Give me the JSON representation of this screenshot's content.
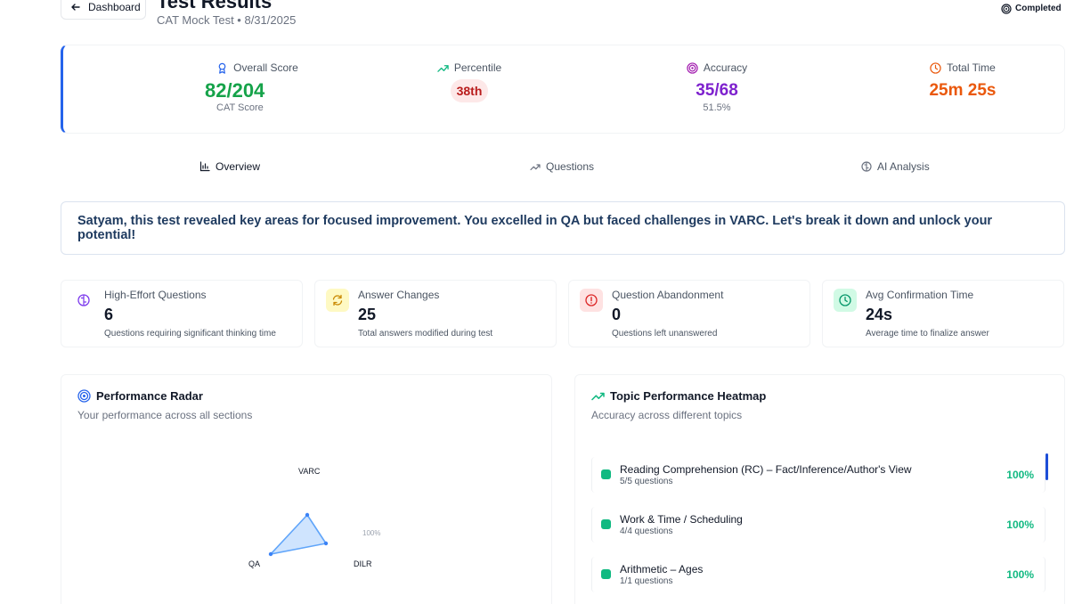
{
  "header": {
    "back_label": "Dashboard",
    "title": "Test Results",
    "subtitle": "CAT Mock Test • 8/31/2025",
    "status": "Completed"
  },
  "summary": {
    "overall_score": {
      "label": "Overall Score",
      "value": "82/204",
      "sub": "CAT Score",
      "color": "#16a34a"
    },
    "percentile": {
      "label": "Percentile",
      "value": "38th",
      "color": "#b91c1c"
    },
    "accuracy": {
      "label": "Accuracy",
      "value": "35/68",
      "sub": "51.5%",
      "color": "#7e22ce"
    },
    "total_time": {
      "label": "Total Time",
      "value": "25m 25s",
      "color": "#ea580c"
    }
  },
  "tabs": [
    {
      "label": "Overview",
      "active": true
    },
    {
      "label": "Questions",
      "active": false
    },
    {
      "label": "AI Analysis",
      "active": false
    }
  ],
  "intro_text": "Satyam, this test revealed key areas for focused improvement. You excelled in QA but faced challenges in VARC. Let's break it down and unlock your potential!",
  "metrics": [
    {
      "title": "High-Effort Questions",
      "value": "6",
      "desc": "Questions requiring significant thinking time",
      "icon": "brain-icon",
      "color": "#7c3aed",
      "bg": "#ffffff"
    },
    {
      "title": "Answer Changes",
      "value": "25",
      "desc": "Total answers modified during test",
      "icon": "refresh-icon",
      "color": "#ca8a04",
      "bg": "#fef9c3"
    },
    {
      "title": "Question Abandonment",
      "value": "0",
      "desc": "Questions left unanswered",
      "icon": "alert-icon",
      "color": "#dc2626",
      "bg": "#fee2e2"
    },
    {
      "title": "Avg Confirmation Time",
      "value": "24s",
      "desc": "Average time to finalize answer",
      "icon": "clock-icon",
      "color": "#059669",
      "bg": "#d1fae5"
    }
  ],
  "radar": {
    "title": "Performance Radar",
    "subtitle": "Your performance across all sections",
    "axes": [
      "VARC",
      "DILR",
      "QA"
    ],
    "max_label": "100%"
  },
  "heatmap": {
    "title": "Topic Performance Heatmap",
    "subtitle": "Accuracy across different topics",
    "topics": [
      {
        "name": "Reading Comprehension (RC) – Fact/Inference/Author's View",
        "count": "5/5 questions",
        "pct": "100%"
      },
      {
        "name": "Work & Time / Scheduling",
        "count": "4/4 questions",
        "pct": "100%"
      },
      {
        "name": "Arithmetic – Ages",
        "count": "1/1 questions",
        "pct": "100%"
      }
    ]
  }
}
